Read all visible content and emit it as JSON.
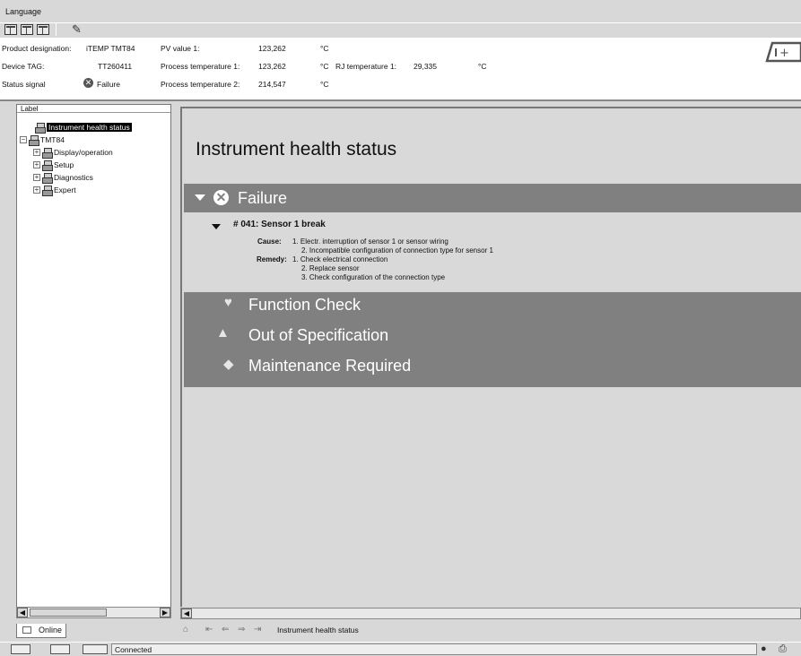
{
  "menu": {
    "language": "Language"
  },
  "header": {
    "product_designation_label": "Product designation:",
    "product_designation_value": "iTEMP TMT84",
    "device_tag_label": "Device TAG:",
    "device_tag_value": "TT260411",
    "status_signal_label": "Status signal",
    "status_signal_value": "Failure",
    "pv_value_label": "PV value 1:",
    "pv_value": "123,262",
    "pv_unit": "°C",
    "process_temp1_label": "Process temperature 1:",
    "process_temp1_value": "123,262",
    "process_temp1_unit": "°C",
    "rj_temp_label": "RJ temperature 1:",
    "rj_temp_value": "29,335",
    "rj_temp_unit": "°C",
    "process_temp2_label": "Process temperature 2:",
    "process_temp2_value": "214,547",
    "process_temp2_unit": "°C"
  },
  "tree": {
    "column_label": "Label",
    "items": [
      {
        "label": "Instrument health status",
        "selected": true
      },
      {
        "label": "TMT84",
        "expander": "−"
      },
      {
        "label": "Display/operation",
        "expander": "+"
      },
      {
        "label": "Setup",
        "expander": "+"
      },
      {
        "label": "Diagnostics",
        "expander": "+"
      },
      {
        "label": "Expert",
        "expander": "+"
      }
    ]
  },
  "tabs": {
    "online": "Online"
  },
  "main": {
    "title": "Instrument health status",
    "categories": {
      "failure": "Failure",
      "function_check": "Function Check",
      "out_of_spec": "Out of Specification",
      "maintenance": "Maintenance Required"
    },
    "event": {
      "code": "# 041: Sensor 1 break",
      "cause_label": "Cause:",
      "cause_lines": [
        "1. Electr. interruption of sensor 1 or sensor wiring",
        "2. Incompatible configuration of connection type for sensor 1"
      ],
      "remedy_label": "Remedy:",
      "remedy_lines": [
        "1. Check electrical connection",
        "2. Replace sensor",
        "3. Check configuration of the connection type"
      ]
    }
  },
  "nav": {
    "breadcrumb": "Instrument health status"
  },
  "statusbar": {
    "connection": "Connected"
  },
  "colors": {
    "band": "#808080",
    "panel": "#d9d9d9",
    "selection": "#000000"
  }
}
